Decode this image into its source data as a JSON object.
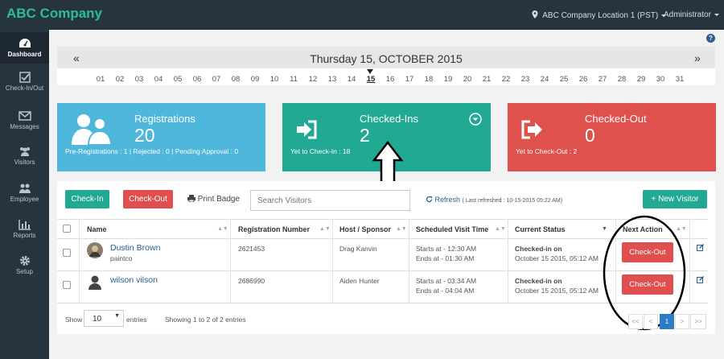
{
  "app": {
    "title": "ABC Company"
  },
  "topbar": {
    "location": "ABC Company Location 1 (PST)",
    "user": "Administrator"
  },
  "sidebar": {
    "items": [
      {
        "label": "Dashboard",
        "icon": "dashboard-icon"
      },
      {
        "label": "Check-In/Out",
        "icon": "checkbox-icon"
      },
      {
        "label": "Messages",
        "icon": "envelope-icon"
      },
      {
        "label": "Visitors",
        "icon": "visitors-icon"
      },
      {
        "label": "Employee",
        "icon": "employee-icon"
      },
      {
        "label": "Reports",
        "icon": "bar-chart-icon"
      },
      {
        "label": "Setup",
        "icon": "gear-icon"
      }
    ]
  },
  "help": "?",
  "datebar": {
    "title": "Thursday 15, OCTOBER 2015",
    "prev": "«",
    "next": "»",
    "days": [
      "01",
      "02",
      "03",
      "04",
      "05",
      "06",
      "07",
      "08",
      "09",
      "10",
      "11",
      "12",
      "13",
      "14",
      "15",
      "16",
      "17",
      "18",
      "19",
      "20",
      "21",
      "22",
      "23",
      "24",
      "25",
      "26",
      "27",
      "28",
      "29",
      "30",
      "31"
    ],
    "selected": "15"
  },
  "cards": {
    "registrations": {
      "title": "Registrations",
      "count": "20",
      "sub": "Pre-Registrations : 1 | Rejected : 0 | Pending Approval : 0",
      "color": "#4fb7dc"
    },
    "checkedin": {
      "title": "Checked-Ins",
      "count": "2",
      "sub": "Yet to Check-In : 18",
      "color": "#22a994"
    },
    "checkedout": {
      "title": "Checked-Out",
      "count": "0",
      "sub": "Yet to Check-Out : 2",
      "color": "#df514d"
    }
  },
  "toolbar": {
    "checkin": "Check-In",
    "checkout": "Check-Out",
    "print": "Print Badge",
    "search_placeholder": "Search Visitors",
    "refresh": "Refresh",
    "last_refreshed": "( Last refreshed : 10-15-2015 05:22 AM)",
    "new_visitor": "+ New Visitor"
  },
  "table": {
    "headers": [
      "Name",
      "Registration Number",
      "Host / Sponsor",
      "Scheduled Visit Time",
      "Current Status",
      "Next Action"
    ],
    "rows": [
      {
        "name": "Dustin Brown",
        "company": "paintco",
        "reg": "2621453",
        "host": "Drag Kanvin",
        "start": "Starts at - 12:30 AM",
        "end": "Ends at - 01:30 AM",
        "status": "Checked-in on",
        "status_date": "October 15 2015, 05:12 AM",
        "action": "Check-Out"
      },
      {
        "name": "wilson vilson",
        "company": "",
        "reg": "2686990",
        "host": "Aiden Hunter",
        "start": "Starts at - 03:34 AM",
        "end": "Ends at - 04:04 AM",
        "status": "Checked-in on",
        "status_date": "October 15 2015, 05:12 AM",
        "action": "Check-Out"
      }
    ]
  },
  "footer": {
    "show": "Show",
    "entries_value": "10",
    "entries": "entries",
    "info": "Showing 1 to 2 of 2 entries",
    "pages": [
      "<<",
      "<",
      "1",
      ">",
      ">>"
    ]
  }
}
